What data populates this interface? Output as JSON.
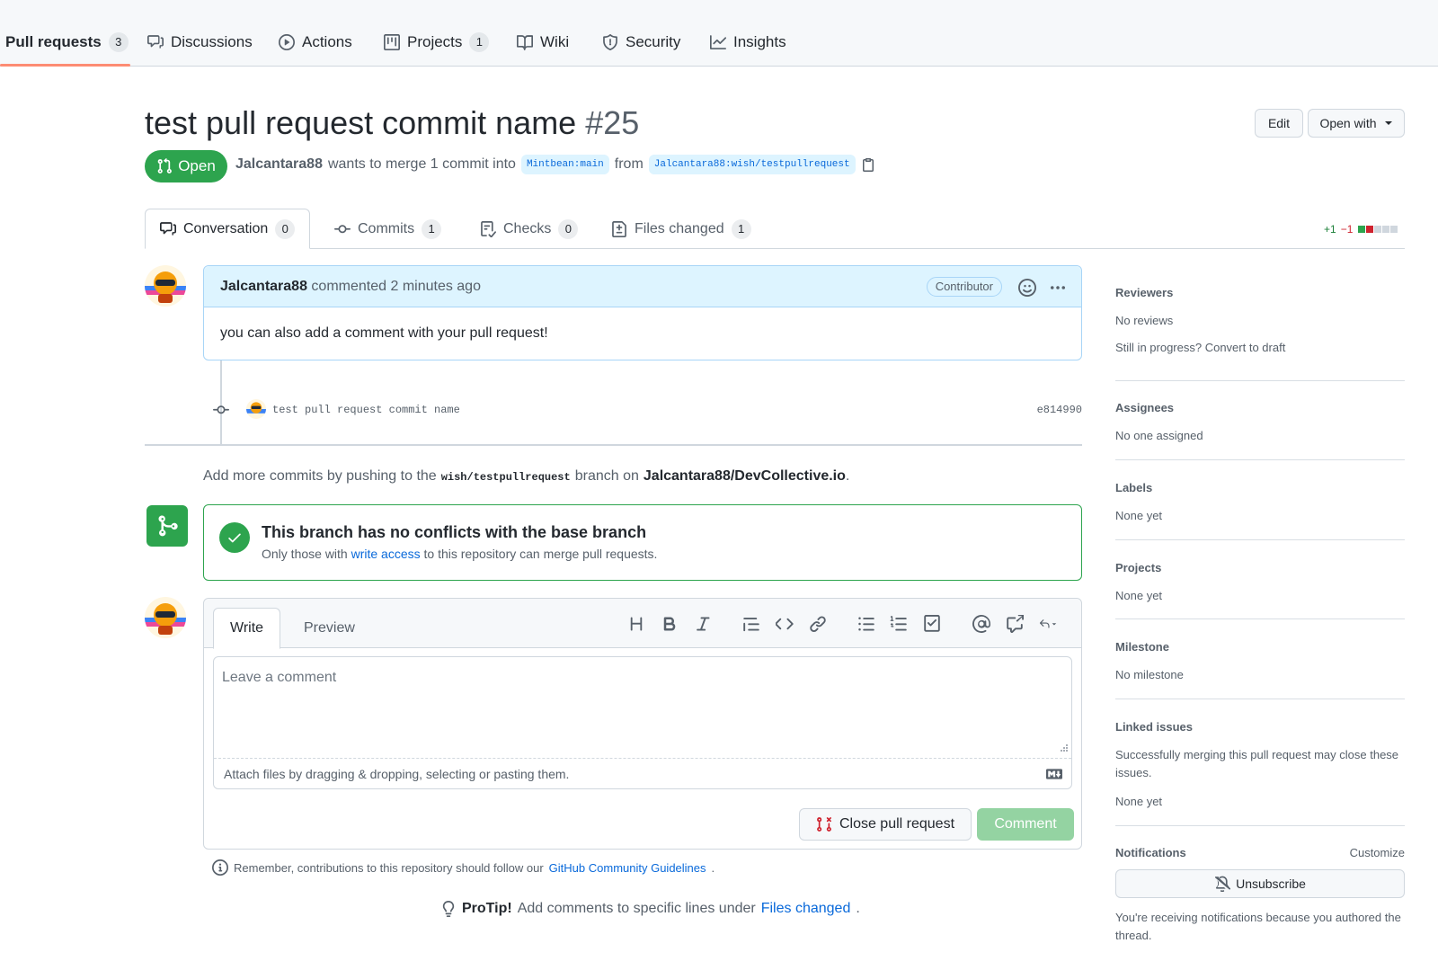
{
  "repo_nav": {
    "items": [
      {
        "label": "Pull requests",
        "count": "3",
        "icon": "git-pull-request-icon",
        "active": true
      },
      {
        "label": "Discussions",
        "icon": "comment-discussion-icon"
      },
      {
        "label": "Actions",
        "icon": "play-icon"
      },
      {
        "label": "Projects",
        "count": "1",
        "icon": "table-icon"
      },
      {
        "label": "Wiki",
        "icon": "book-icon"
      },
      {
        "label": "Security",
        "icon": "shield-icon"
      },
      {
        "label": "Insights",
        "icon": "graph-icon"
      }
    ]
  },
  "header": {
    "title": "test pull request commit name",
    "number": "#25",
    "edit_label": "Edit",
    "open_with_label": "Open with",
    "state": "Open",
    "author": "Jalcantara88",
    "merge_text": "wants to merge 1 commit into",
    "base_branch": "Mintbean:main",
    "from_text": "from",
    "head_branch": "Jalcantara88:wish/testpullrequest"
  },
  "pr_tabs": [
    {
      "label": "Conversation",
      "count": "0",
      "active": true
    },
    {
      "label": "Commits",
      "count": "1"
    },
    {
      "label": "Checks",
      "count": "0"
    },
    {
      "label": "Files changed",
      "count": "1"
    }
  ],
  "diffstat": {
    "additions": "+1",
    "deletions": "−1"
  },
  "comment": {
    "author": "Jalcantara88",
    "action": "commented",
    "time": "2 minutes ago",
    "badge": "Contributor",
    "body": "you can also add a comment with your pull request!"
  },
  "commit": {
    "message": "test pull request commit name",
    "sha": "e814990"
  },
  "push_hint": {
    "prefix": "Add more commits by pushing to the",
    "branch": "wish/testpullrequest",
    "middle": "branch on",
    "repo": "Jalcantara88/DevCollective.io",
    "suffix": "."
  },
  "merge_status": {
    "title": "This branch has no conflicts with the base branch",
    "sub_prefix": "Only those with",
    "sub_link": "write access",
    "sub_suffix": "to this repository can merge pull requests."
  },
  "form": {
    "write_tab": "Write",
    "preview_tab": "Preview",
    "placeholder": "Leave a comment",
    "attach_text": "Attach files by dragging & dropping, selecting or pasting them.",
    "close_label": "Close pull request",
    "comment_label": "Comment"
  },
  "remember": {
    "text": "Remember, contributions to this repository should follow our",
    "link": "GitHub Community Guidelines",
    "suffix": "."
  },
  "protip": {
    "bold": "ProTip!",
    "text": "Add comments to specific lines under",
    "link": "Files changed",
    "suffix": "."
  },
  "sidebar": {
    "reviewers": {
      "title": "Reviewers",
      "value": "No reviews",
      "extra": "Still in progress? Convert to draft"
    },
    "assignees": {
      "title": "Assignees",
      "value": "No one assigned"
    },
    "labels": {
      "title": "Labels",
      "value": "None yet"
    },
    "projects": {
      "title": "Projects",
      "value": "None yet"
    },
    "milestone": {
      "title": "Milestone",
      "value": "No milestone"
    },
    "linked_issues": {
      "title": "Linked issues",
      "desc": "Successfully merging this pull request may close these issues.",
      "value": "None yet"
    },
    "notifications": {
      "title": "Notifications",
      "customize": "Customize",
      "unsubscribe": "Unsubscribe",
      "desc": "You're receiving notifications because you authored the thread."
    }
  },
  "colors": {
    "open_green": "#2da44e",
    "link_blue": "#0969da",
    "tab_underline": "#fd8c73",
    "deletion_red": "#cf222e"
  }
}
